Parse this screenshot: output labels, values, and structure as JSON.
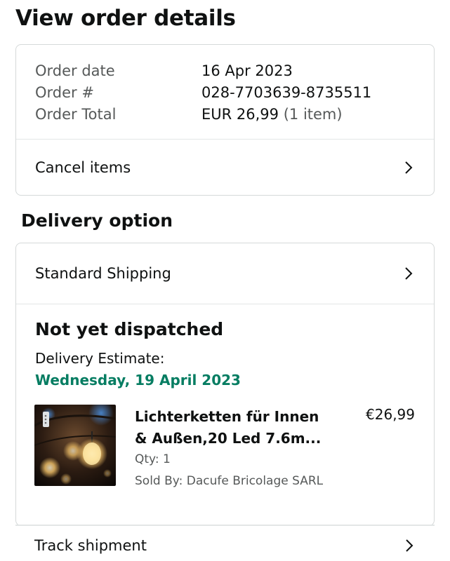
{
  "header": {
    "title": "View order details"
  },
  "order_summary": {
    "rows": [
      {
        "label": "Order date",
        "value": "16 Apr 2023"
      },
      {
        "label": "Order #",
        "value": "028-7703639-8735511"
      },
      {
        "label": "Order Total",
        "value": "EUR 26,99",
        "note": "(1 item)"
      }
    ],
    "cancel_label": "Cancel items"
  },
  "delivery": {
    "heading": "Delivery option",
    "shipping_method": "Standard Shipping",
    "status": "Not yet dispatched",
    "estimate_label": "Delivery Estimate:",
    "estimate_date": "Wednesday, 19 April 2023",
    "estimate_color": "#067d62",
    "item": {
      "title_line1": "Lichterketten für Innen",
      "title_line2": "& Außen,20 Led 7.6m...",
      "price": "€26,99",
      "qty": "Qty: 1",
      "seller": "Sold By: Dacufe Bricolage SARL",
      "image_icon": "string-lights-photo"
    }
  },
  "track": {
    "label": "Track shipment"
  },
  "icons": {
    "chevron": "chevron-right-icon"
  }
}
